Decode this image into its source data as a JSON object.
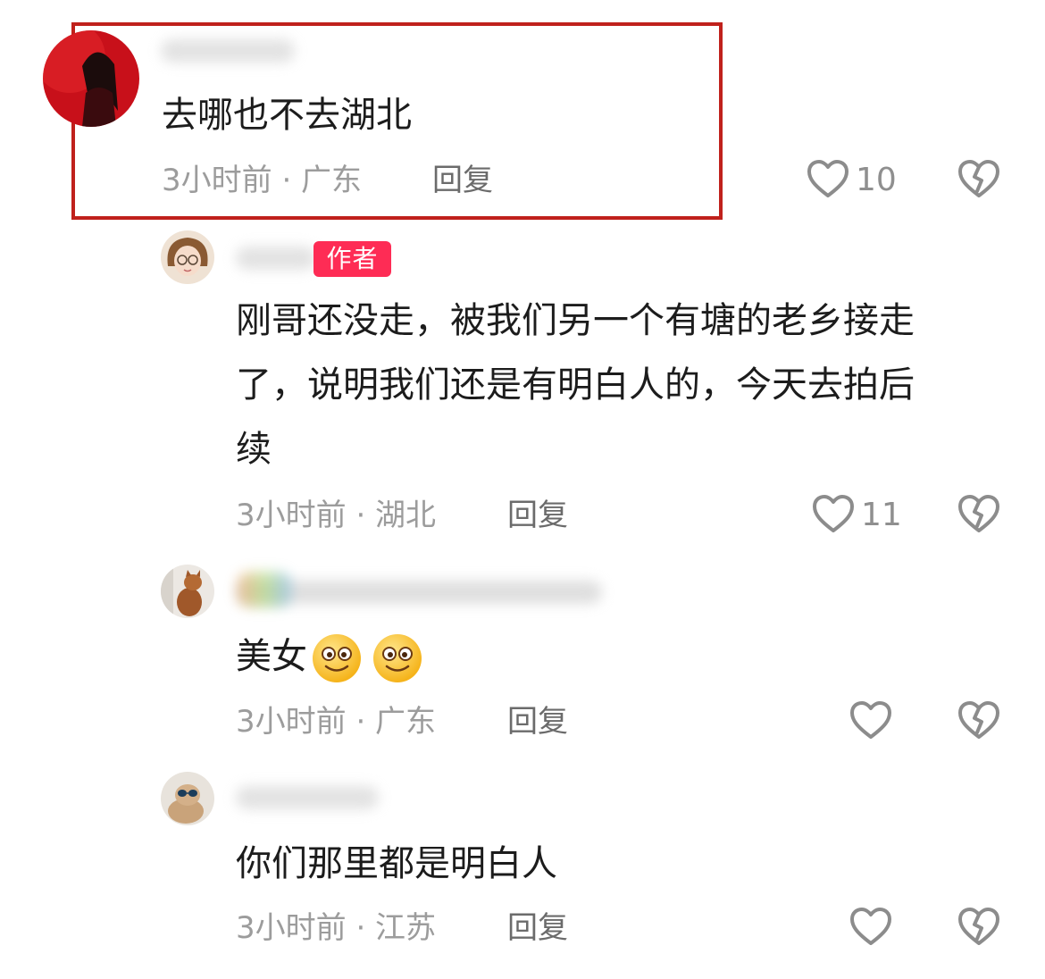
{
  "comments": [
    {
      "text": "去哪也不去湖北",
      "meta": "3小时前 · 广东",
      "reply": "回复",
      "likes": "10",
      "highlighted": true
    },
    {
      "badge": "作者",
      "lines": [
        "刚哥还没走，被我们另一个有塘的老乡接走",
        "了，说明我们还是有明白人的，今天去拍后",
        "续"
      ],
      "meta": "3小时前 · 湖北",
      "reply": "回复",
      "likes": "11"
    },
    {
      "text": "美女",
      "emoji": [
        "smiling-face",
        "smiling-face"
      ],
      "meta": "3小时前 · 广东",
      "reply": "回复"
    },
    {
      "text": "你们那里都是明白人",
      "meta": "3小时前 · 江苏",
      "reply": "回复"
    }
  ],
  "icons": {
    "like": "heart-outline-icon",
    "dislike": "broken-heart-icon"
  },
  "colors": {
    "highlight_border": "#c0211c",
    "author_badge": "#fe2c55",
    "meta_text": "#9c9c9c"
  }
}
